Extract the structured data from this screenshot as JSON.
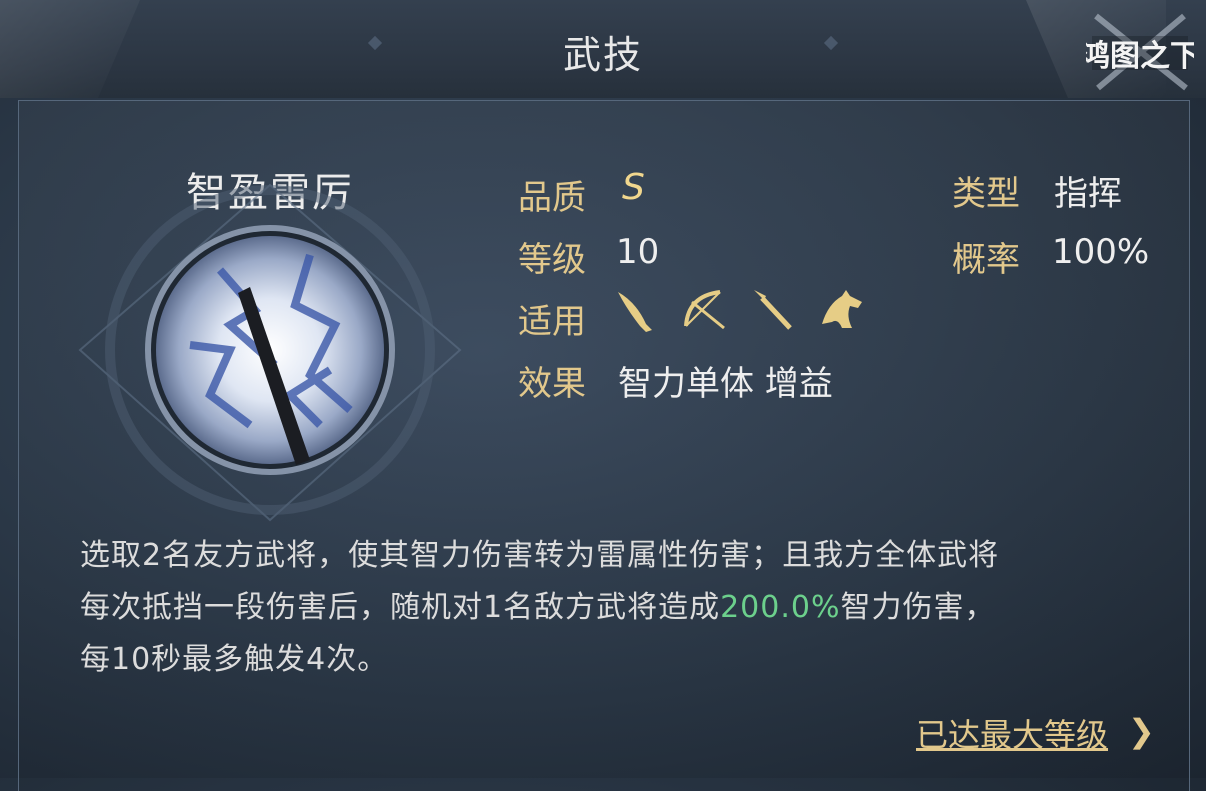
{
  "header": {
    "title": "武技"
  },
  "logo": {
    "text": "鸿图之下"
  },
  "skill": {
    "name": "智盈雷厉",
    "attributes": {
      "quality_label": "品质",
      "quality_value": "S",
      "type_label": "类型",
      "type_value": "指挥",
      "level_label": "等级",
      "level_value": "10",
      "rate_label": "概率",
      "rate_value": "100%",
      "applicable_label": "适用",
      "effect_label": "效果",
      "effect_value": "智力单体 增益"
    },
    "applicable_units": [
      "blade-icon",
      "bow-icon",
      "spear-icon",
      "horse-icon"
    ],
    "description": {
      "line1": "选取2名友方武将，使其智力伤害转为雷属性伤害；且我方全体武将",
      "line2_pre": "每次抵挡一段伤害后，随机对1名敌方武将造成",
      "line2_highlight": "200.0%",
      "line2_post": "智力伤害，",
      "line3": "每10秒最多触发4次。"
    },
    "max_level_link": "已达最大等级",
    "max_level_chevron": "❯"
  },
  "colors": {
    "label_gold": "#e2c88c",
    "highlight_green": "#6cd08c",
    "text_white": "#eeeeee"
  }
}
